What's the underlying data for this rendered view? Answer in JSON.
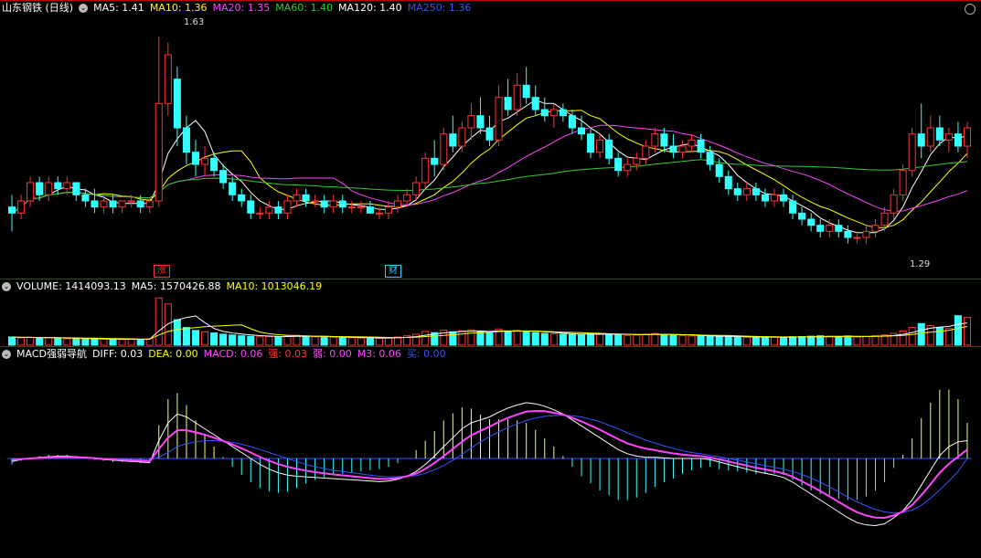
{
  "price_header": {
    "title": "山东钢铁 (日线)",
    "items": [
      {
        "label": "MA5: 1.41",
        "color": "#ffffff"
      },
      {
        "label": "MA10: 1.36",
        "color": "#ffff00"
      },
      {
        "label": "MA20: 1.35",
        "color": "#ff44ff"
      },
      {
        "label": "MA60: 1.40",
        "color": "#33cc33"
      },
      {
        "label": "MA120: 1.40",
        "color": "#ffffff"
      },
      {
        "label": "MA250: 1.36",
        "color": "#3355ff"
      }
    ]
  },
  "volume_header": {
    "items": [
      {
        "label": "VOLUME: 1414093.13",
        "color": "#ffffff"
      },
      {
        "label": "MA5: 1570426.88",
        "color": "#ffffff"
      },
      {
        "label": "MA10: 1013046.19",
        "color": "#ffff00"
      }
    ]
  },
  "macd_header": {
    "title": "MACD强弱导航",
    "items": [
      {
        "label": "DIFF: 0.03",
        "color": "#ffffff"
      },
      {
        "label": "DEA: 0.00",
        "color": "#ffff00"
      },
      {
        "label": "MACD: 0.06",
        "color": "#ff44ff"
      },
      {
        "label": "强: 0.03",
        "color": "#ff3333"
      },
      {
        "label": "弱: 0.00",
        "color": "#ff44ff"
      },
      {
        "label": "M3: 0.06",
        "color": "#ff44ff"
      },
      {
        "label": "买: 0.00",
        "color": "#3355ff"
      }
    ]
  },
  "price_annotations": {
    "high_label": "1.63",
    "low_label": "1.29"
  },
  "event_tags": [
    {
      "label": "涨",
      "color": "#ff3333"
    },
    {
      "label": "财",
      "color": "#33ccff"
    }
  ],
  "chart_data": {
    "type": "candlestick",
    "bars": 105,
    "price_range": [
      1.24,
      1.66
    ],
    "price_high": 1.63,
    "price_low": 1.29,
    "candles": [
      [
        1.35,
        1.37,
        1.31,
        1.34
      ],
      [
        1.34,
        1.37,
        1.33,
        1.36
      ],
      [
        1.36,
        1.4,
        1.35,
        1.39
      ],
      [
        1.39,
        1.4,
        1.36,
        1.37
      ],
      [
        1.37,
        1.4,
        1.36,
        1.39
      ],
      [
        1.39,
        1.4,
        1.37,
        1.38
      ],
      [
        1.38,
        1.4,
        1.37,
        1.39
      ],
      [
        1.39,
        1.39,
        1.36,
        1.37
      ],
      [
        1.37,
        1.38,
        1.35,
        1.36
      ],
      [
        1.36,
        1.38,
        1.34,
        1.35
      ],
      [
        1.35,
        1.37,
        1.34,
        1.36
      ],
      [
        1.36,
        1.37,
        1.34,
        1.35
      ],
      [
        1.35,
        1.36,
        1.34,
        1.36
      ],
      [
        1.36,
        1.37,
        1.35,
        1.36
      ],
      [
        1.36,
        1.37,
        1.34,
        1.35
      ],
      [
        1.35,
        1.36,
        1.34,
        1.36
      ],
      [
        1.36,
        1.63,
        1.35,
        1.52
      ],
      [
        1.52,
        1.62,
        1.5,
        1.6
      ],
      [
        1.56,
        1.58,
        1.45,
        1.48
      ],
      [
        1.48,
        1.5,
        1.42,
        1.44
      ],
      [
        1.44,
        1.46,
        1.4,
        1.42
      ],
      [
        1.42,
        1.45,
        1.4,
        1.43
      ],
      [
        1.43,
        1.44,
        1.4,
        1.41
      ],
      [
        1.41,
        1.42,
        1.38,
        1.39
      ],
      [
        1.39,
        1.4,
        1.36,
        1.37
      ],
      [
        1.37,
        1.38,
        1.35,
        1.36
      ],
      [
        1.36,
        1.37,
        1.33,
        1.34
      ],
      [
        1.34,
        1.35,
        1.33,
        1.34
      ],
      [
        1.34,
        1.36,
        1.33,
        1.35
      ],
      [
        1.35,
        1.36,
        1.33,
        1.34
      ],
      [
        1.34,
        1.37,
        1.33,
        1.36
      ],
      [
        1.36,
        1.38,
        1.35,
        1.37
      ],
      [
        1.37,
        1.38,
        1.35,
        1.36
      ],
      [
        1.36,
        1.37,
        1.35,
        1.36
      ],
      [
        1.36,
        1.37,
        1.34,
        1.35
      ],
      [
        1.35,
        1.37,
        1.34,
        1.36
      ],
      [
        1.36,
        1.37,
        1.34,
        1.35
      ],
      [
        1.35,
        1.36,
        1.34,
        1.35
      ],
      [
        1.35,
        1.36,
        1.34,
        1.35
      ],
      [
        1.35,
        1.36,
        1.34,
        1.34
      ],
      [
        1.34,
        1.35,
        1.33,
        1.34
      ],
      [
        1.34,
        1.36,
        1.33,
        1.35
      ],
      [
        1.35,
        1.37,
        1.34,
        1.36
      ],
      [
        1.36,
        1.38,
        1.35,
        1.37
      ],
      [
        1.37,
        1.4,
        1.36,
        1.39
      ],
      [
        1.39,
        1.44,
        1.38,
        1.43
      ],
      [
        1.43,
        1.46,
        1.4,
        1.42
      ],
      [
        1.42,
        1.48,
        1.41,
        1.47
      ],
      [
        1.47,
        1.5,
        1.44,
        1.45
      ],
      [
        1.45,
        1.49,
        1.44,
        1.48
      ],
      [
        1.48,
        1.52,
        1.46,
        1.5
      ],
      [
        1.5,
        1.53,
        1.47,
        1.48
      ],
      [
        1.48,
        1.5,
        1.45,
        1.46
      ],
      [
        1.46,
        1.55,
        1.45,
        1.53
      ],
      [
        1.53,
        1.56,
        1.5,
        1.51
      ],
      [
        1.51,
        1.57,
        1.5,
        1.55
      ],
      [
        1.55,
        1.58,
        1.52,
        1.53
      ],
      [
        1.53,
        1.55,
        1.5,
        1.51
      ],
      [
        1.51,
        1.53,
        1.49,
        1.5
      ],
      [
        1.5,
        1.52,
        1.48,
        1.51
      ],
      [
        1.51,
        1.52,
        1.49,
        1.5
      ],
      [
        1.5,
        1.51,
        1.47,
        1.48
      ],
      [
        1.48,
        1.5,
        1.46,
        1.47
      ],
      [
        1.47,
        1.48,
        1.43,
        1.44
      ],
      [
        1.44,
        1.47,
        1.43,
        1.46
      ],
      [
        1.46,
        1.47,
        1.42,
        1.43
      ],
      [
        1.43,
        1.44,
        1.4,
        1.41
      ],
      [
        1.41,
        1.43,
        1.4,
        1.42
      ],
      [
        1.42,
        1.44,
        1.41,
        1.43
      ],
      [
        1.43,
        1.46,
        1.42,
        1.45
      ],
      [
        1.45,
        1.48,
        1.44,
        1.47
      ],
      [
        1.47,
        1.48,
        1.44,
        1.45
      ],
      [
        1.45,
        1.47,
        1.43,
        1.44
      ],
      [
        1.44,
        1.46,
        1.43,
        1.45
      ],
      [
        1.45,
        1.47,
        1.44,
        1.46
      ],
      [
        1.46,
        1.47,
        1.43,
        1.44
      ],
      [
        1.44,
        1.45,
        1.41,
        1.42
      ],
      [
        1.42,
        1.43,
        1.39,
        1.4
      ],
      [
        1.4,
        1.41,
        1.37,
        1.38
      ],
      [
        1.38,
        1.39,
        1.36,
        1.37
      ],
      [
        1.37,
        1.39,
        1.36,
        1.38
      ],
      [
        1.38,
        1.39,
        1.36,
        1.37
      ],
      [
        1.37,
        1.38,
        1.35,
        1.36
      ],
      [
        1.36,
        1.38,
        1.35,
        1.37
      ],
      [
        1.37,
        1.38,
        1.35,
        1.36
      ],
      [
        1.36,
        1.37,
        1.33,
        1.34
      ],
      [
        1.34,
        1.35,
        1.32,
        1.33
      ],
      [
        1.33,
        1.34,
        1.31,
        1.32
      ],
      [
        1.32,
        1.33,
        1.3,
        1.31
      ],
      [
        1.31,
        1.33,
        1.3,
        1.32
      ],
      [
        1.32,
        1.33,
        1.3,
        1.31
      ],
      [
        1.31,
        1.32,
        1.29,
        1.3
      ],
      [
        1.3,
        1.31,
        1.29,
        1.3
      ],
      [
        1.3,
        1.32,
        1.29,
        1.31
      ],
      [
        1.31,
        1.33,
        1.3,
        1.32
      ],
      [
        1.32,
        1.35,
        1.31,
        1.34
      ],
      [
        1.34,
        1.38,
        1.33,
        1.37
      ],
      [
        1.37,
        1.42,
        1.36,
        1.41
      ],
      [
        1.41,
        1.48,
        1.4,
        1.47
      ],
      [
        1.47,
        1.52,
        1.43,
        1.45
      ],
      [
        1.45,
        1.5,
        1.44,
        1.48
      ],
      [
        1.48,
        1.5,
        1.45,
        1.46
      ],
      [
        1.46,
        1.48,
        1.44,
        1.47
      ],
      [
        1.47,
        1.49,
        1.44,
        1.45
      ],
      [
        1.45,
        1.49,
        1.43,
        1.48
      ]
    ],
    "volume_range": [
      0,
      2600000
    ],
    "volume": [
      420000,
      380000,
      400000,
      350000,
      390000,
      360000,
      330000,
      340000,
      310000,
      300000,
      320000,
      300000,
      290000,
      310000,
      300000,
      330000,
      2400000,
      2100000,
      1300000,
      900000,
      750000,
      680000,
      620000,
      560000,
      520000,
      480000,
      450000,
      430000,
      440000,
      420000,
      470000,
      500000,
      460000,
      430000,
      410000,
      400000,
      390000,
      380000,
      370000,
      360000,
      350000,
      380000,
      420000,
      480000,
      560000,
      700000,
      640000,
      760000,
      680000,
      720000,
      780000,
      690000,
      620000,
      820000,
      700000,
      760000,
      690000,
      640000,
      600000,
      580000,
      560000,
      540000,
      520000,
      600000,
      560000,
      580000,
      540000,
      500000,
      520000,
      560000,
      600000,
      540000,
      500000,
      480000,
      470000,
      460000,
      450000,
      440000,
      430000,
      420000,
      410000,
      400000,
      420000,
      410000,
      400000,
      430000,
      440000,
      460000,
      480000,
      450000,
      430000,
      470000,
      420000,
      450000,
      480000,
      520000,
      600000,
      720000,
      900000,
      1100000,
      1000000,
      900000,
      850000,
      1500000,
      1414093
    ],
    "macd_range": [
      -0.16,
      0.16
    ],
    "diff": [
      -0.005,
      -0.002,
      0.0,
      0.002,
      0.003,
      0.004,
      0.004,
      0.003,
      0.002,
      0.0,
      -0.002,
      -0.003,
      -0.004,
      -0.005,
      -0.006,
      -0.007,
      0.03,
      0.06,
      0.075,
      0.07,
      0.06,
      0.05,
      0.04,
      0.03,
      0.02,
      0.01,
      0.0,
      -0.01,
      -0.018,
      -0.024,
      -0.028,
      -0.03,
      -0.031,
      -0.032,
      -0.033,
      -0.034,
      -0.035,
      -0.036,
      -0.037,
      -0.038,
      -0.039,
      -0.038,
      -0.035,
      -0.03,
      -0.022,
      -0.01,
      0.004,
      0.02,
      0.035,
      0.05,
      0.06,
      0.065,
      0.07,
      0.078,
      0.085,
      0.09,
      0.094,
      0.092,
      0.088,
      0.082,
      0.075,
      0.065,
      0.055,
      0.045,
      0.035,
      0.025,
      0.015,
      0.008,
      0.004,
      0.002,
      0.002,
      0.001,
      0.0,
      0.0,
      0.0,
      0.0,
      -0.002,
      -0.006,
      -0.01,
      -0.014,
      -0.018,
      -0.022,
      -0.025,
      -0.028,
      -0.032,
      -0.04,
      -0.05,
      -0.06,
      -0.07,
      -0.08,
      -0.09,
      -0.1,
      -0.108,
      -0.112,
      -0.113,
      -0.11,
      -0.1,
      -0.088,
      -0.07,
      -0.045,
      -0.02,
      0.005,
      0.02,
      0.028,
      0.03
    ],
    "dea": [
      0.0,
      0.0,
      0.0,
      0.0,
      0.0,
      0.001,
      0.001,
      0.001,
      0.001,
      0.001,
      0.0,
      0.0,
      -0.001,
      -0.002,
      -0.002,
      -0.003,
      0.002,
      0.01,
      0.02,
      0.025,
      0.028,
      0.03,
      0.03,
      0.029,
      0.027,
      0.024,
      0.02,
      0.015,
      0.01,
      0.005,
      0.0,
      -0.005,
      -0.01,
      -0.014,
      -0.017,
      -0.02,
      -0.022,
      -0.024,
      -0.026,
      -0.028,
      -0.03,
      -0.031,
      -0.031,
      -0.03,
      -0.029,
      -0.025,
      -0.019,
      -0.012,
      -0.003,
      0.007,
      0.018,
      0.028,
      0.037,
      0.045,
      0.052,
      0.058,
      0.064,
      0.068,
      0.071,
      0.072,
      0.073,
      0.072,
      0.07,
      0.066,
      0.062,
      0.056,
      0.05,
      0.043,
      0.037,
      0.031,
      0.026,
      0.021,
      0.017,
      0.013,
      0.01,
      0.008,
      0.005,
      0.003,
      0.0,
      -0.003,
      -0.006,
      -0.009,
      -0.012,
      -0.015,
      -0.018,
      -0.022,
      -0.027,
      -0.033,
      -0.04,
      -0.048,
      -0.056,
      -0.065,
      -0.073,
      -0.08,
      -0.086,
      -0.09,
      -0.092,
      -0.091,
      -0.087,
      -0.079,
      -0.067,
      -0.053,
      -0.038,
      -0.022,
      0.0
    ]
  }
}
